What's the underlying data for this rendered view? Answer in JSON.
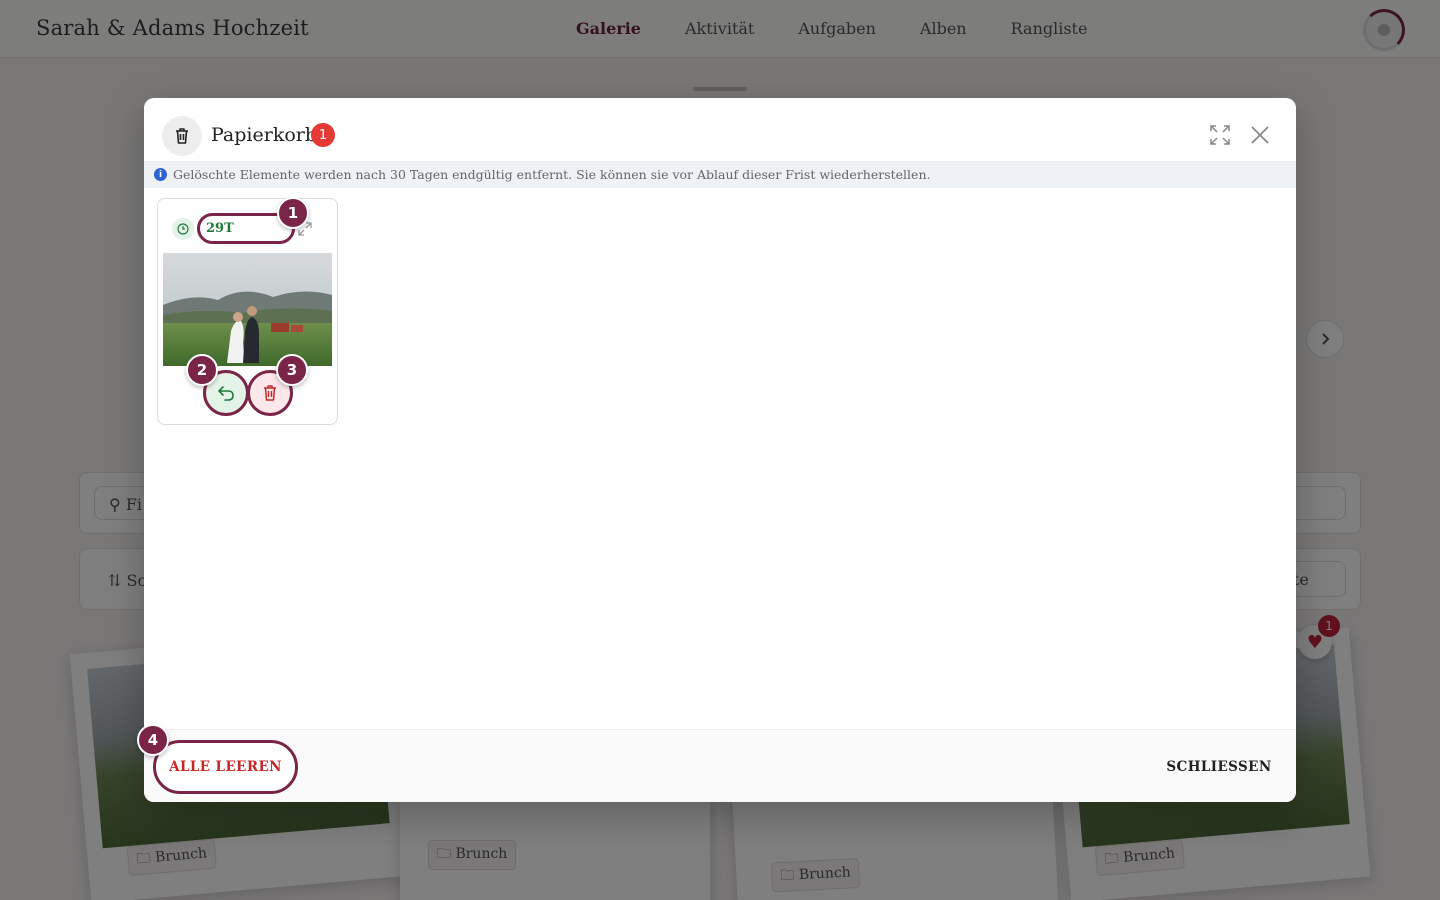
{
  "app": {
    "title": "Sarah & Adams Hochzeit",
    "nav": [
      {
        "label": "Galerie",
        "active": true
      },
      {
        "label": "Aktivität",
        "active": false
      },
      {
        "label": "Aufgaben",
        "active": false
      },
      {
        "label": "Alben",
        "active": false
      },
      {
        "label": "Rangliste",
        "active": false
      }
    ]
  },
  "background": {
    "filter_label": "Fi",
    "sort_label": "Sor",
    "sort_value_partial": "ueste",
    "photo_tags": [
      "Brunch",
      "Brunch",
      "Brunch",
      "Brunch"
    ],
    "likes_count": "1"
  },
  "modal": {
    "title": "Papierkorb",
    "count": "1",
    "info_text": "Gelöschte Elemente werden nach 30 Tagen endgültig entfernt. Sie können sie vor Ablauf dieser Frist wiederherstellen.",
    "items": [
      {
        "days_left": "29T",
        "photo_icon": "wedding-couple-photo"
      }
    ],
    "clear_all_label": "ALLE LEEREN",
    "close_label": "SCHLIESSEN"
  },
  "steps": [
    "1",
    "2",
    "3",
    "4"
  ],
  "colors": {
    "accent": "#7a2447",
    "danger": "#e53935",
    "success": "#1e7a3d"
  }
}
